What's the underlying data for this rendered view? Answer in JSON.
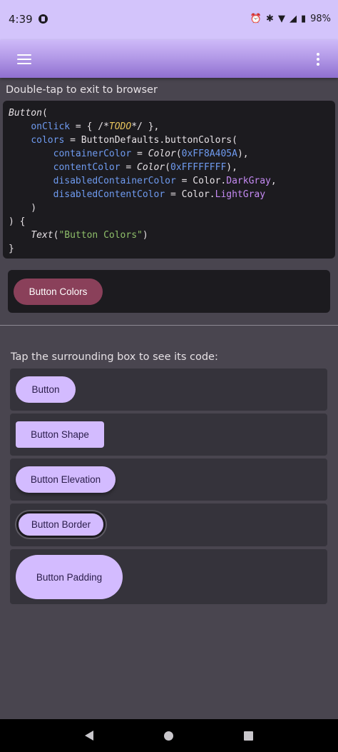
{
  "status_bar": {
    "time": "4:39",
    "battery": "98%",
    "icons": [
      "alarm-icon",
      "bluetooth-icon",
      "wifi-icon",
      "signal-icon",
      "battery-icon"
    ]
  },
  "app_bar": {
    "menu_icon": "hamburger-icon",
    "overflow_icon": "kebab-icon",
    "accent": "#b49be8"
  },
  "hint_top": "Double-tap to exit to browser",
  "code": {
    "l1": {
      "fn": "Button",
      "rest": "("
    },
    "l2": {
      "indent": "    ",
      "param": "onClick",
      "eq": " = { /*",
      "todo": "TODO",
      "end": "*/ },"
    },
    "l3": {
      "indent": "    ",
      "param": "colors",
      "eq": " = ButtonDefaults.buttonColors("
    },
    "l4": {
      "indent": "        ",
      "param": "containerColor",
      "eq": " = ",
      "fn": "Color",
      "open": "(",
      "num": "0xFF8A405A",
      "close": "),"
    },
    "l5": {
      "indent": "        ",
      "param": "contentColor",
      "eq": " = ",
      "fn": "Color",
      "open": "(",
      "num": "0xFFFFFFFF",
      "close": "),"
    },
    "l6": {
      "indent": "        ",
      "param": "disabledContainerColor",
      "eq": " = Color.",
      "prop": "DarkGray",
      "close": ","
    },
    "l7": {
      "indent": "        ",
      "param": "disabledContentColor",
      "eq": " = Color.",
      "prop": "LightGray"
    },
    "l8": "    )",
    "l9": ") {",
    "l10": {
      "indent": "    ",
      "fn": "Text",
      "open": "(",
      "str": "\"Button Colors\"",
      "close": ")"
    },
    "l11": "}"
  },
  "preview": {
    "button_label": "Button Colors",
    "button_color": "#8a405a"
  },
  "hint_bottom": "Tap the surrounding box to see its code:",
  "samples": [
    {
      "label": "Button"
    },
    {
      "label": "Button Shape"
    },
    {
      "label": "Button Elevation"
    },
    {
      "label": "Button Border"
    },
    {
      "label": "Button Padding"
    }
  ],
  "nav": {
    "back_icon": "back-icon",
    "home_icon": "home-icon",
    "recents_icon": "recents-icon"
  }
}
